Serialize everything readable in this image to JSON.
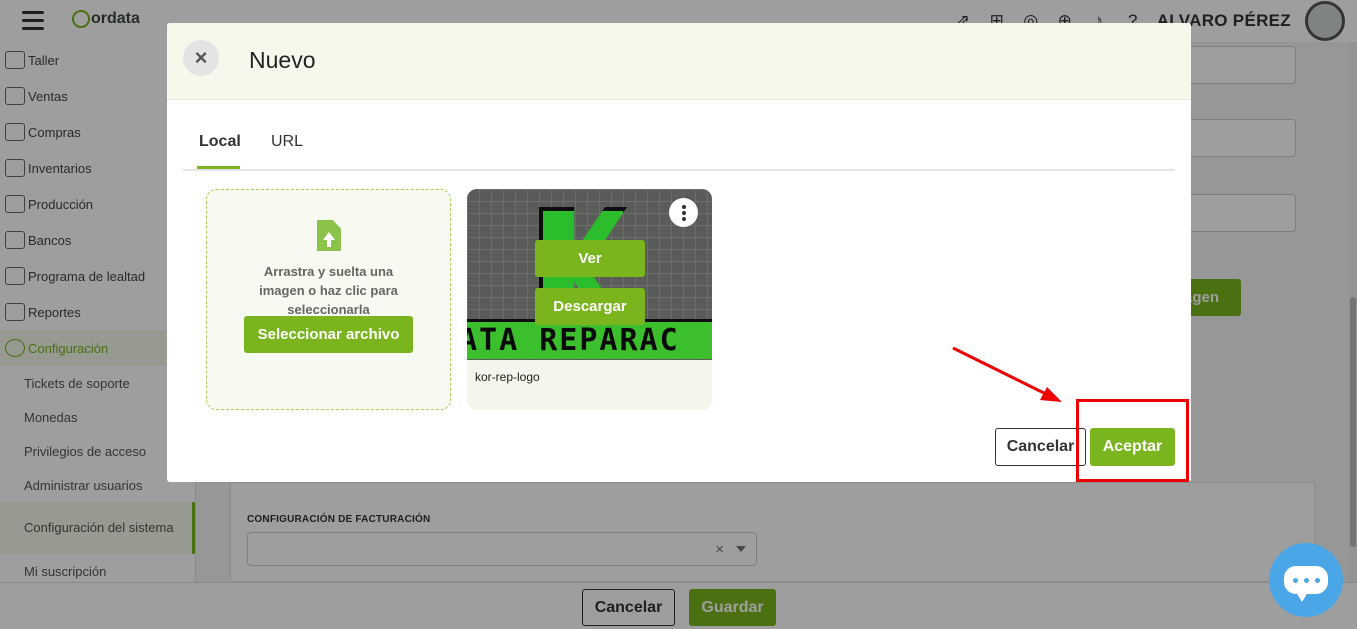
{
  "app": {
    "logo_text": "ordata",
    "user_name": "ALVARO PÉREZ",
    "top_icons": [
      "external-link-icon",
      "gift-icon",
      "badge-icon",
      "plus-circle-icon",
      "bell-icon",
      "help-icon"
    ]
  },
  "sidebar": {
    "items": [
      {
        "label": "Taller",
        "icon": "wrench-icon"
      },
      {
        "label": "Ventas",
        "icon": "sales-icon"
      },
      {
        "label": "Compras",
        "icon": "cart-icon"
      },
      {
        "label": "Inventarios",
        "icon": "inventory-icon"
      },
      {
        "label": "Producción",
        "icon": "production-icon"
      },
      {
        "label": "Bancos",
        "icon": "bank-icon"
      },
      {
        "label": "Programa de lealtad",
        "icon": "loyalty-icon"
      },
      {
        "label": "Reportes",
        "icon": "reports-icon"
      },
      {
        "label": "Configuración",
        "icon": "gear-icon"
      }
    ],
    "subitems": [
      {
        "label": "Tickets de soporte"
      },
      {
        "label": "Monedas"
      },
      {
        "label": "Privilegios de acceso"
      },
      {
        "label": "Administrar usuarios"
      },
      {
        "label": "Configuración del sistema"
      },
      {
        "label": "Mi suscripción"
      }
    ]
  },
  "background": {
    "image_button_partial": "agen",
    "billing_label": "CONFIGURACIÓN DE FACTURACIÓN",
    "select_clear": "×",
    "footer": {
      "cancel": "Cancelar",
      "save": "Guardar"
    }
  },
  "modal": {
    "title": "Nuevo",
    "close_icon": "×",
    "tabs": [
      {
        "label": "Local",
        "active": true
      },
      {
        "label": "URL",
        "active": false
      }
    ],
    "dropzone": {
      "text": "Arrastra y suelta una imagen o haz clic para seleccionarla",
      "button": "Seleccionar archivo"
    },
    "image_card": {
      "name": "kor-rep-logo",
      "banner_text": "ATA REPARAC",
      "view_button": "Ver",
      "download_button": "Descargar"
    },
    "cancel": "Cancelar",
    "accept": "Aceptar"
  },
  "colors": {
    "brand_green": "#7ab51d",
    "annotation_red": "#ee0000",
    "chat_blue": "#4aa6e6"
  }
}
